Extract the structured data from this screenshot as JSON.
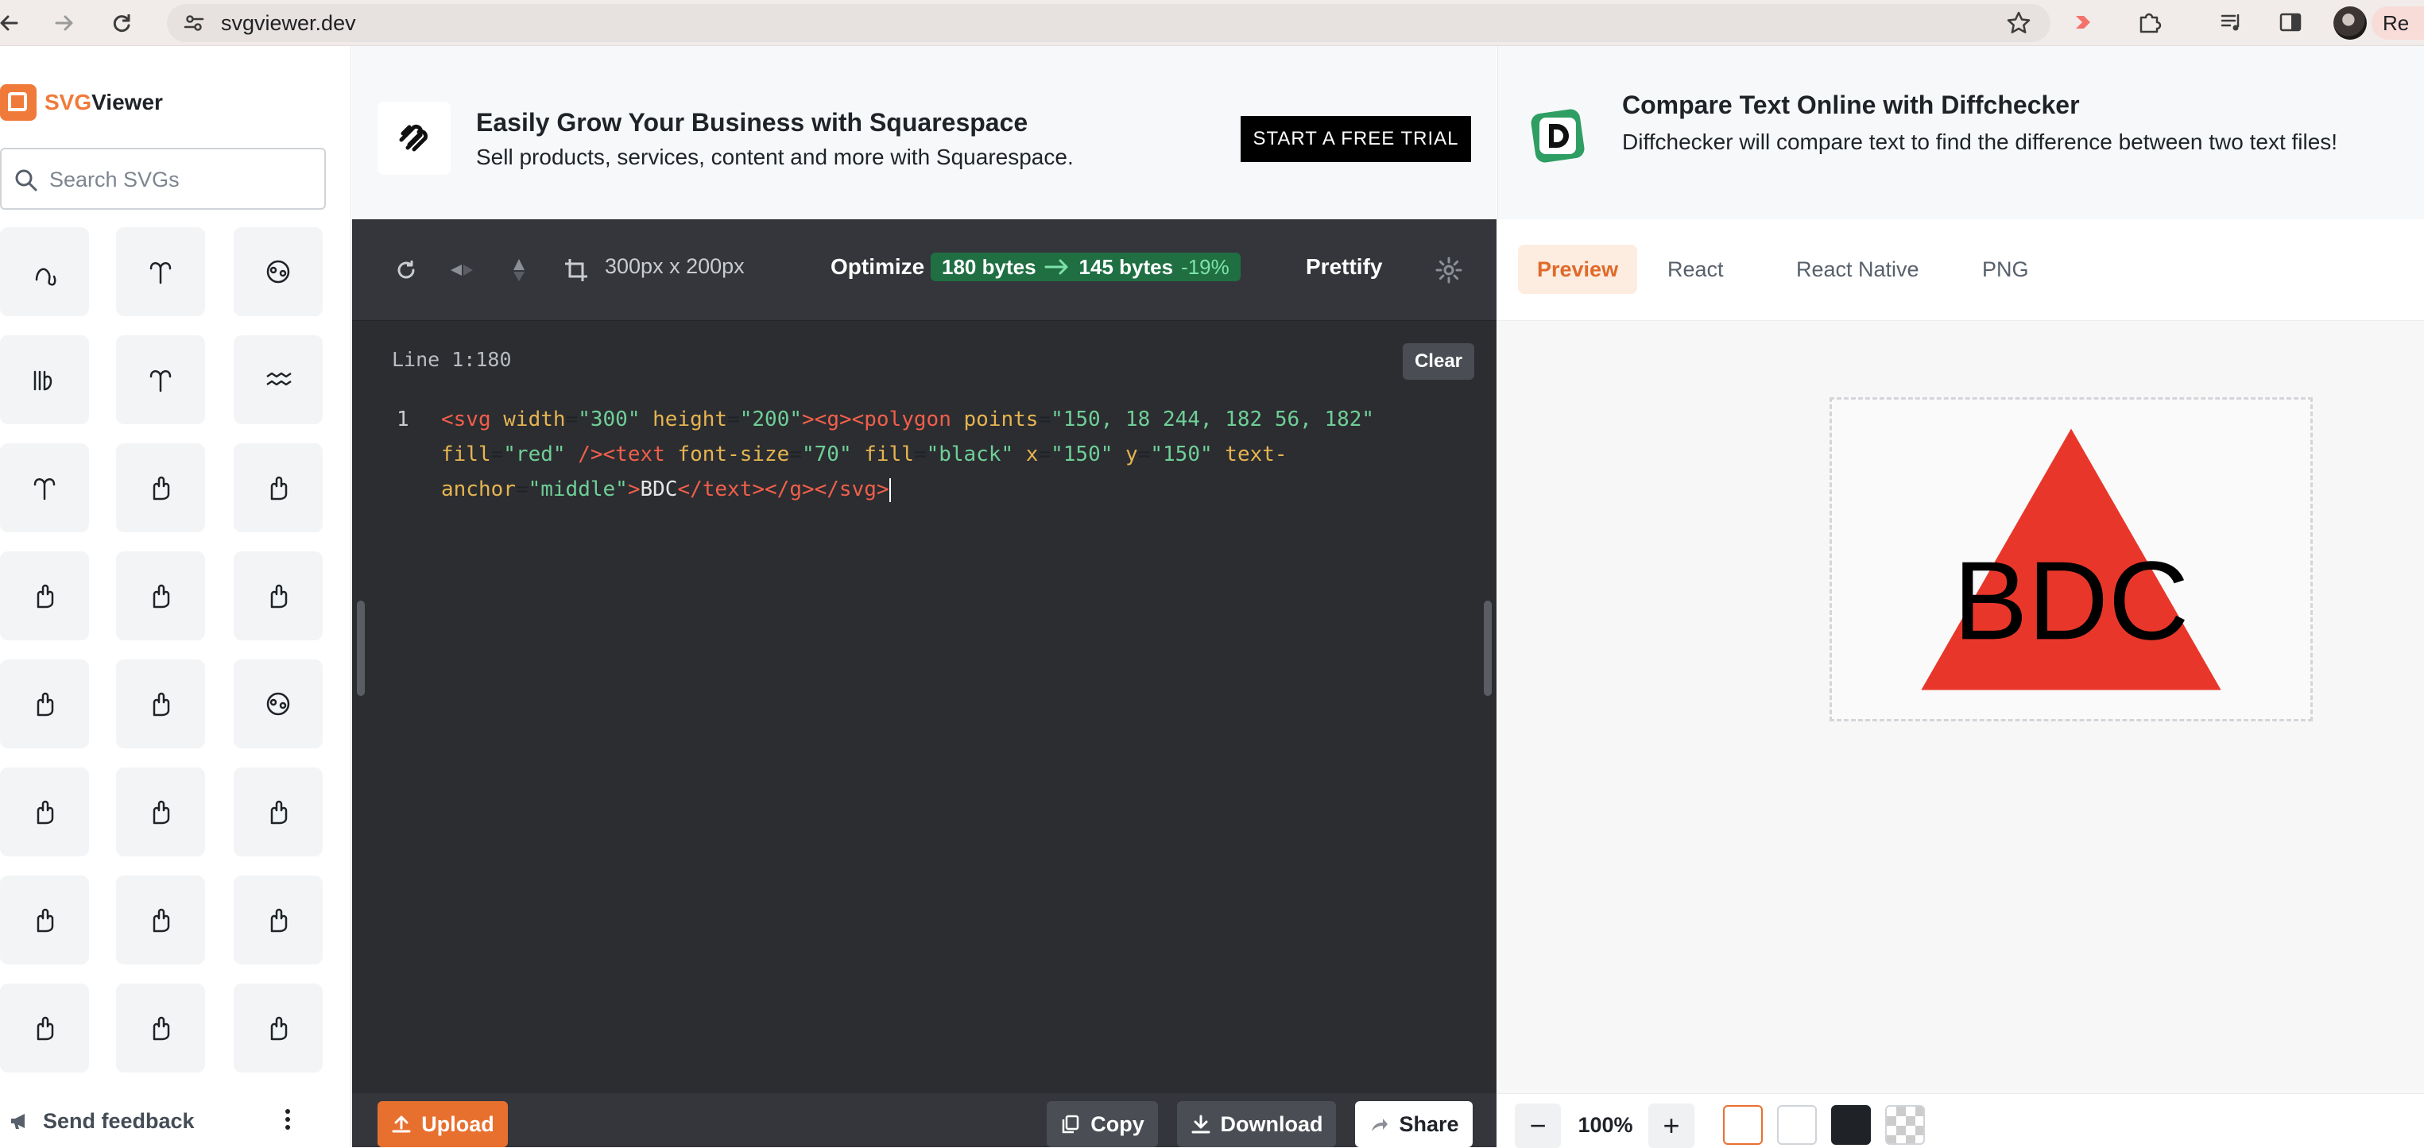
{
  "browser": {
    "url": "svgviewer.dev",
    "profile_label": "Re"
  },
  "sidebar": {
    "brand_accent": "SVG",
    "brand_rest": "Viewer",
    "search_placeholder": "Search SVGs",
    "feedback_label": "Send feedback",
    "icons": [
      "leo-zodiac-icon",
      "aries-zodiac-icon",
      "cancer-zodiac-icon",
      "virgo-zodiac-icon",
      "aries-zodiac-icon",
      "aquarius-zodiac-icon",
      "aries-zodiac-icon",
      "hand-raised-icon",
      "hand-stop-icon",
      "hand-point-left-icon",
      "hand-ok-icon",
      "hand-vulcan-icon",
      "hand-clap-icon",
      "hand-back-icon",
      "hand-cloud-icon",
      "hand-rock-icon",
      "hand-peace-icon",
      "hand-love-icon",
      "hand-four-icon",
      "hand-victory-icon",
      "hand-point-right-icon",
      "hand-fist-icon",
      "hand-grab-icon",
      "hand-open-icon"
    ]
  },
  "ads": {
    "squarespace": {
      "title": "Easily Grow Your Business with Squarespace",
      "subtitle": "Sell products, services, content and more with Squarespace.",
      "cta": "START A FREE TRIAL"
    },
    "diffchecker": {
      "title": "Compare Text Online with Diffchecker",
      "subtitle": "Diffchecker will compare text to find the difference between two text files!"
    }
  },
  "editor": {
    "dimensions": "300px x 200px",
    "optimize_label": "Optimize",
    "size_before": "180 bytes",
    "size_after": "145 bytes",
    "size_delta": "-19%",
    "prettify_label": "Prettify",
    "line_info": "Line 1:180",
    "clear_label": "Clear",
    "line_number": "1",
    "upload_label": "Upload",
    "copy_label": "Copy",
    "download_label": "Download",
    "share_label": "Share"
  },
  "preview": {
    "tabs": [
      "Preview",
      "React",
      "React Native",
      "PNG"
    ],
    "active_tab": "Preview",
    "zoom": "100%",
    "svg_text": "BDC",
    "svg_fill": "#e8372a",
    "swatches": [
      "#ffffff",
      "#ffffff",
      "#1f2328",
      "checkerboard"
    ]
  },
  "colors": {
    "accent": "#e8702f",
    "editor_bg": "#2b2d31",
    "optimize_green": "#1f6f43"
  }
}
